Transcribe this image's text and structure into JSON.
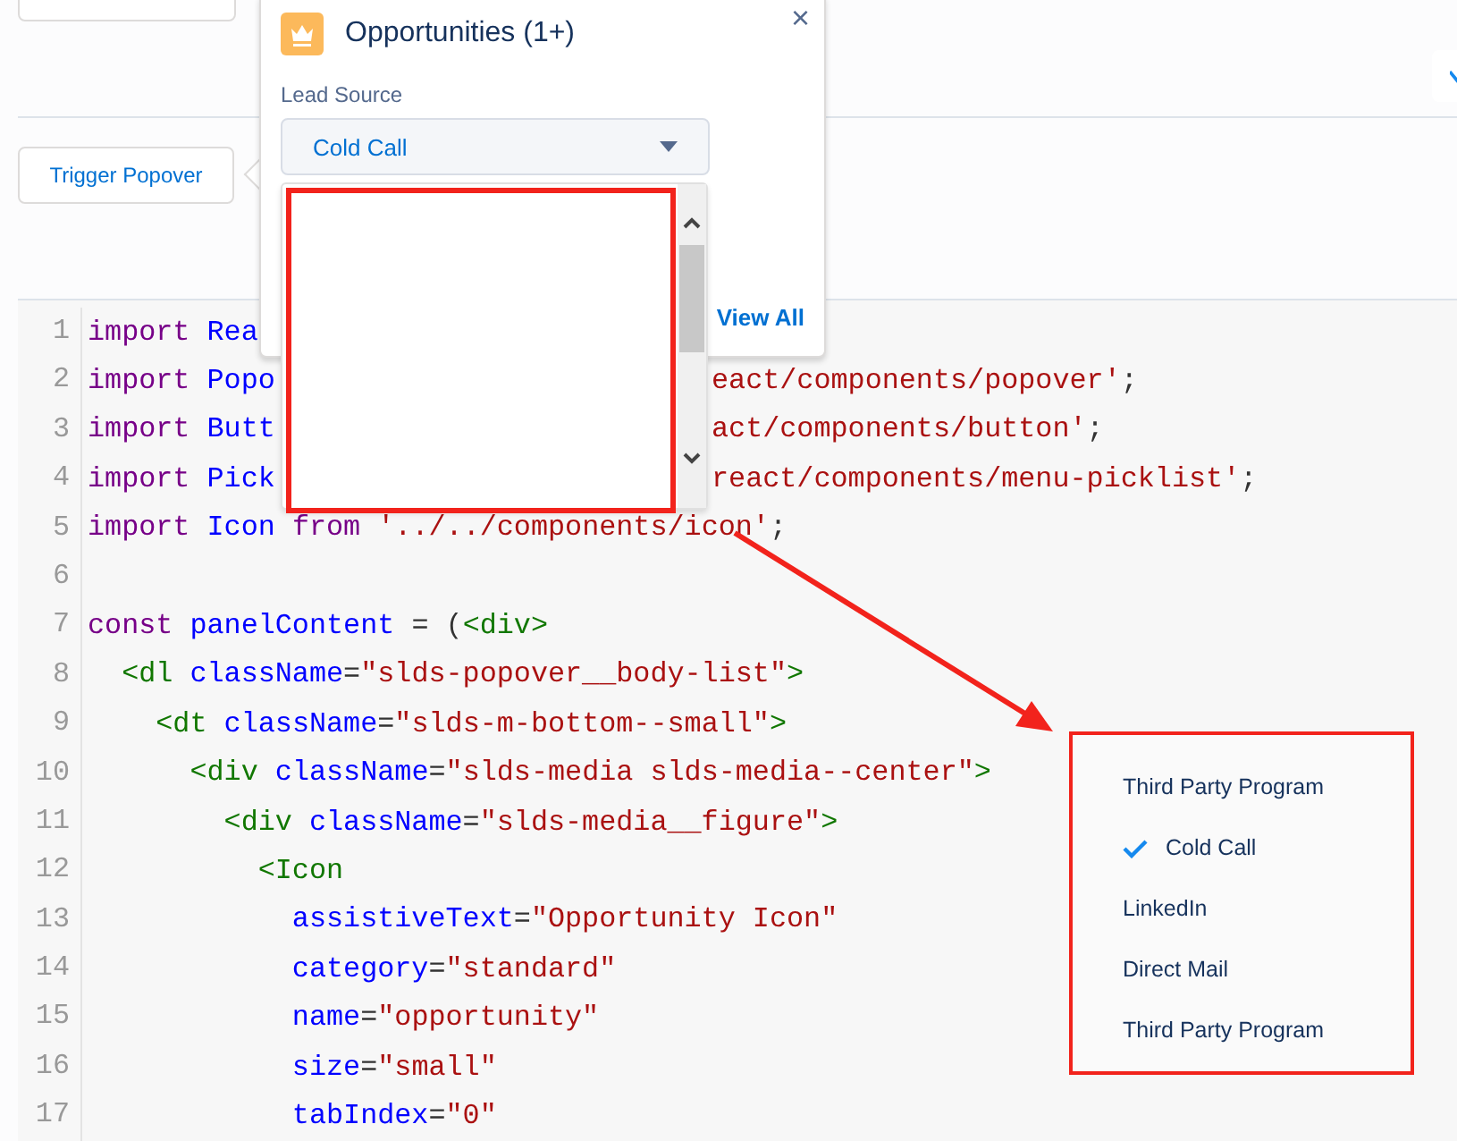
{
  "popover": {
    "title": "Opportunities (1+)",
    "close": "×",
    "field_label": "Lead Source",
    "picklist": {
      "value": "Cold Call"
    },
    "footer_link": "View All"
  },
  "trigger_button": {
    "label": "Trigger Popover"
  },
  "code": {
    "lines": [
      {
        "number": "1",
        "segments": [
          [
            {
              "t": "import ",
              "kind": "kw"
            },
            {
              "t": "Rea",
              "kind": "var"
            }
          ]
        ]
      },
      {
        "number": "2",
        "segments": [
          [
            {
              "t": "import ",
              "kind": "kw"
            },
            {
              "t": "Popo",
              "kind": "var"
            }
          ],
          [
            {
              "t": "eact/components/popover'",
              "kind": "str"
            },
            {
              "t": ";",
              "kind": "plain"
            }
          ]
        ]
      },
      {
        "number": "3",
        "segments": [
          [
            {
              "t": "import ",
              "kind": "kw"
            },
            {
              "t": "Butt",
              "kind": "var"
            }
          ],
          [
            {
              "t": "act/components/button'",
              "kind": "str"
            },
            {
              "t": ";",
              "kind": "plain"
            }
          ]
        ]
      },
      {
        "number": "4",
        "segments": [
          [
            {
              "t": "import ",
              "kind": "kw"
            },
            {
              "t": "Pick",
              "kind": "var"
            }
          ],
          [
            {
              "t": "react/components/menu-picklist'",
              "kind": "str"
            },
            {
              "t": ";",
              "kind": "plain"
            }
          ]
        ]
      },
      {
        "number": "5",
        "segments": [
          [
            {
              "t": "import ",
              "kind": "kw"
            },
            {
              "t": "Icon ",
              "kind": "var"
            },
            {
              "t": "from ",
              "kind": "kw"
            },
            {
              "t": "'../../components/icon'",
              "kind": "str"
            },
            {
              "t": ";",
              "kind": "plain"
            }
          ]
        ]
      },
      {
        "number": "6"
      },
      {
        "number": "7",
        "segments": [
          [
            {
              "t": "const ",
              "kind": "kw"
            },
            {
              "t": "panelContent",
              "kind": "var"
            },
            {
              "t": " = (",
              "kind": "plain"
            },
            {
              "t": "<div>",
              "kind": "tag"
            }
          ]
        ]
      },
      {
        "number": "8",
        "segments": [
          [
            {
              "t": "  <dl ",
              "kind": "tag"
            },
            {
              "t": "className",
              "kind": "var"
            },
            {
              "t": "=",
              "kind": "plain"
            },
            {
              "t": "\"slds-popover__body-list\"",
              "kind": "str"
            },
            {
              "t": ">",
              "kind": "tag"
            }
          ]
        ]
      },
      {
        "number": "9",
        "segments": [
          [
            {
              "t": "    <dt ",
              "kind": "tag"
            },
            {
              "t": "className",
              "kind": "var"
            },
            {
              "t": "=",
              "kind": "plain"
            },
            {
              "t": "\"slds-m-bottom--small\"",
              "kind": "str"
            },
            {
              "t": ">",
              "kind": "tag"
            }
          ]
        ]
      },
      {
        "number": "10",
        "segments": [
          [
            {
              "t": "      <div ",
              "kind": "tag"
            },
            {
              "t": "className",
              "kind": "var"
            },
            {
              "t": "=",
              "kind": "plain"
            },
            {
              "t": "\"slds-media slds-media--center\"",
              "kind": "str"
            },
            {
              "t": ">",
              "kind": "tag"
            }
          ]
        ]
      },
      {
        "number": "11",
        "segments": [
          [
            {
              "t": "        <div ",
              "kind": "tag"
            },
            {
              "t": "className",
              "kind": "var"
            },
            {
              "t": "=",
              "kind": "plain"
            },
            {
              "t": "\"slds-media__figure\"",
              "kind": "str"
            },
            {
              "t": ">",
              "kind": "tag"
            }
          ]
        ]
      },
      {
        "number": "12",
        "segments": [
          [
            {
              "t": "          <Icon",
              "kind": "tag"
            }
          ]
        ]
      },
      {
        "number": "13",
        "segments": [
          [
            {
              "t": "            assistiveText",
              "kind": "var"
            },
            {
              "t": "=",
              "kind": "plain"
            },
            {
              "t": "\"Opportunity Icon\"",
              "kind": "str"
            }
          ]
        ]
      },
      {
        "number": "14",
        "segments": [
          [
            {
              "t": "            category",
              "kind": "var"
            },
            {
              "t": "=",
              "kind": "plain"
            },
            {
              "t": "\"standard\"",
              "kind": "str"
            }
          ]
        ]
      },
      {
        "number": "15",
        "segments": [
          [
            {
              "t": "            name",
              "kind": "var"
            },
            {
              "t": "=",
              "kind": "plain"
            },
            {
              "t": "\"opportunity\"",
              "kind": "str"
            }
          ]
        ]
      },
      {
        "number": "16",
        "segments": [
          [
            {
              "t": "            size",
              "kind": "var"
            },
            {
              "t": "=",
              "kind": "plain"
            },
            {
              "t": "\"small\"",
              "kind": "str"
            }
          ]
        ]
      },
      {
        "number": "17",
        "segments": [
          [
            {
              "t": "            tabIndex",
              "kind": "var"
            },
            {
              "t": "=",
              "kind": "plain"
            },
            {
              "t": "\"0\"",
              "kind": "str"
            }
          ]
        ]
      }
    ]
  },
  "callout": {
    "items": [
      {
        "label": "Third Party Program",
        "selected": false
      },
      {
        "label": "Cold Call",
        "selected": true
      },
      {
        "label": "LinkedIn",
        "selected": false
      },
      {
        "label": "Direct Mail",
        "selected": false
      },
      {
        "label": "Third Party Program",
        "selected": false
      }
    ]
  }
}
